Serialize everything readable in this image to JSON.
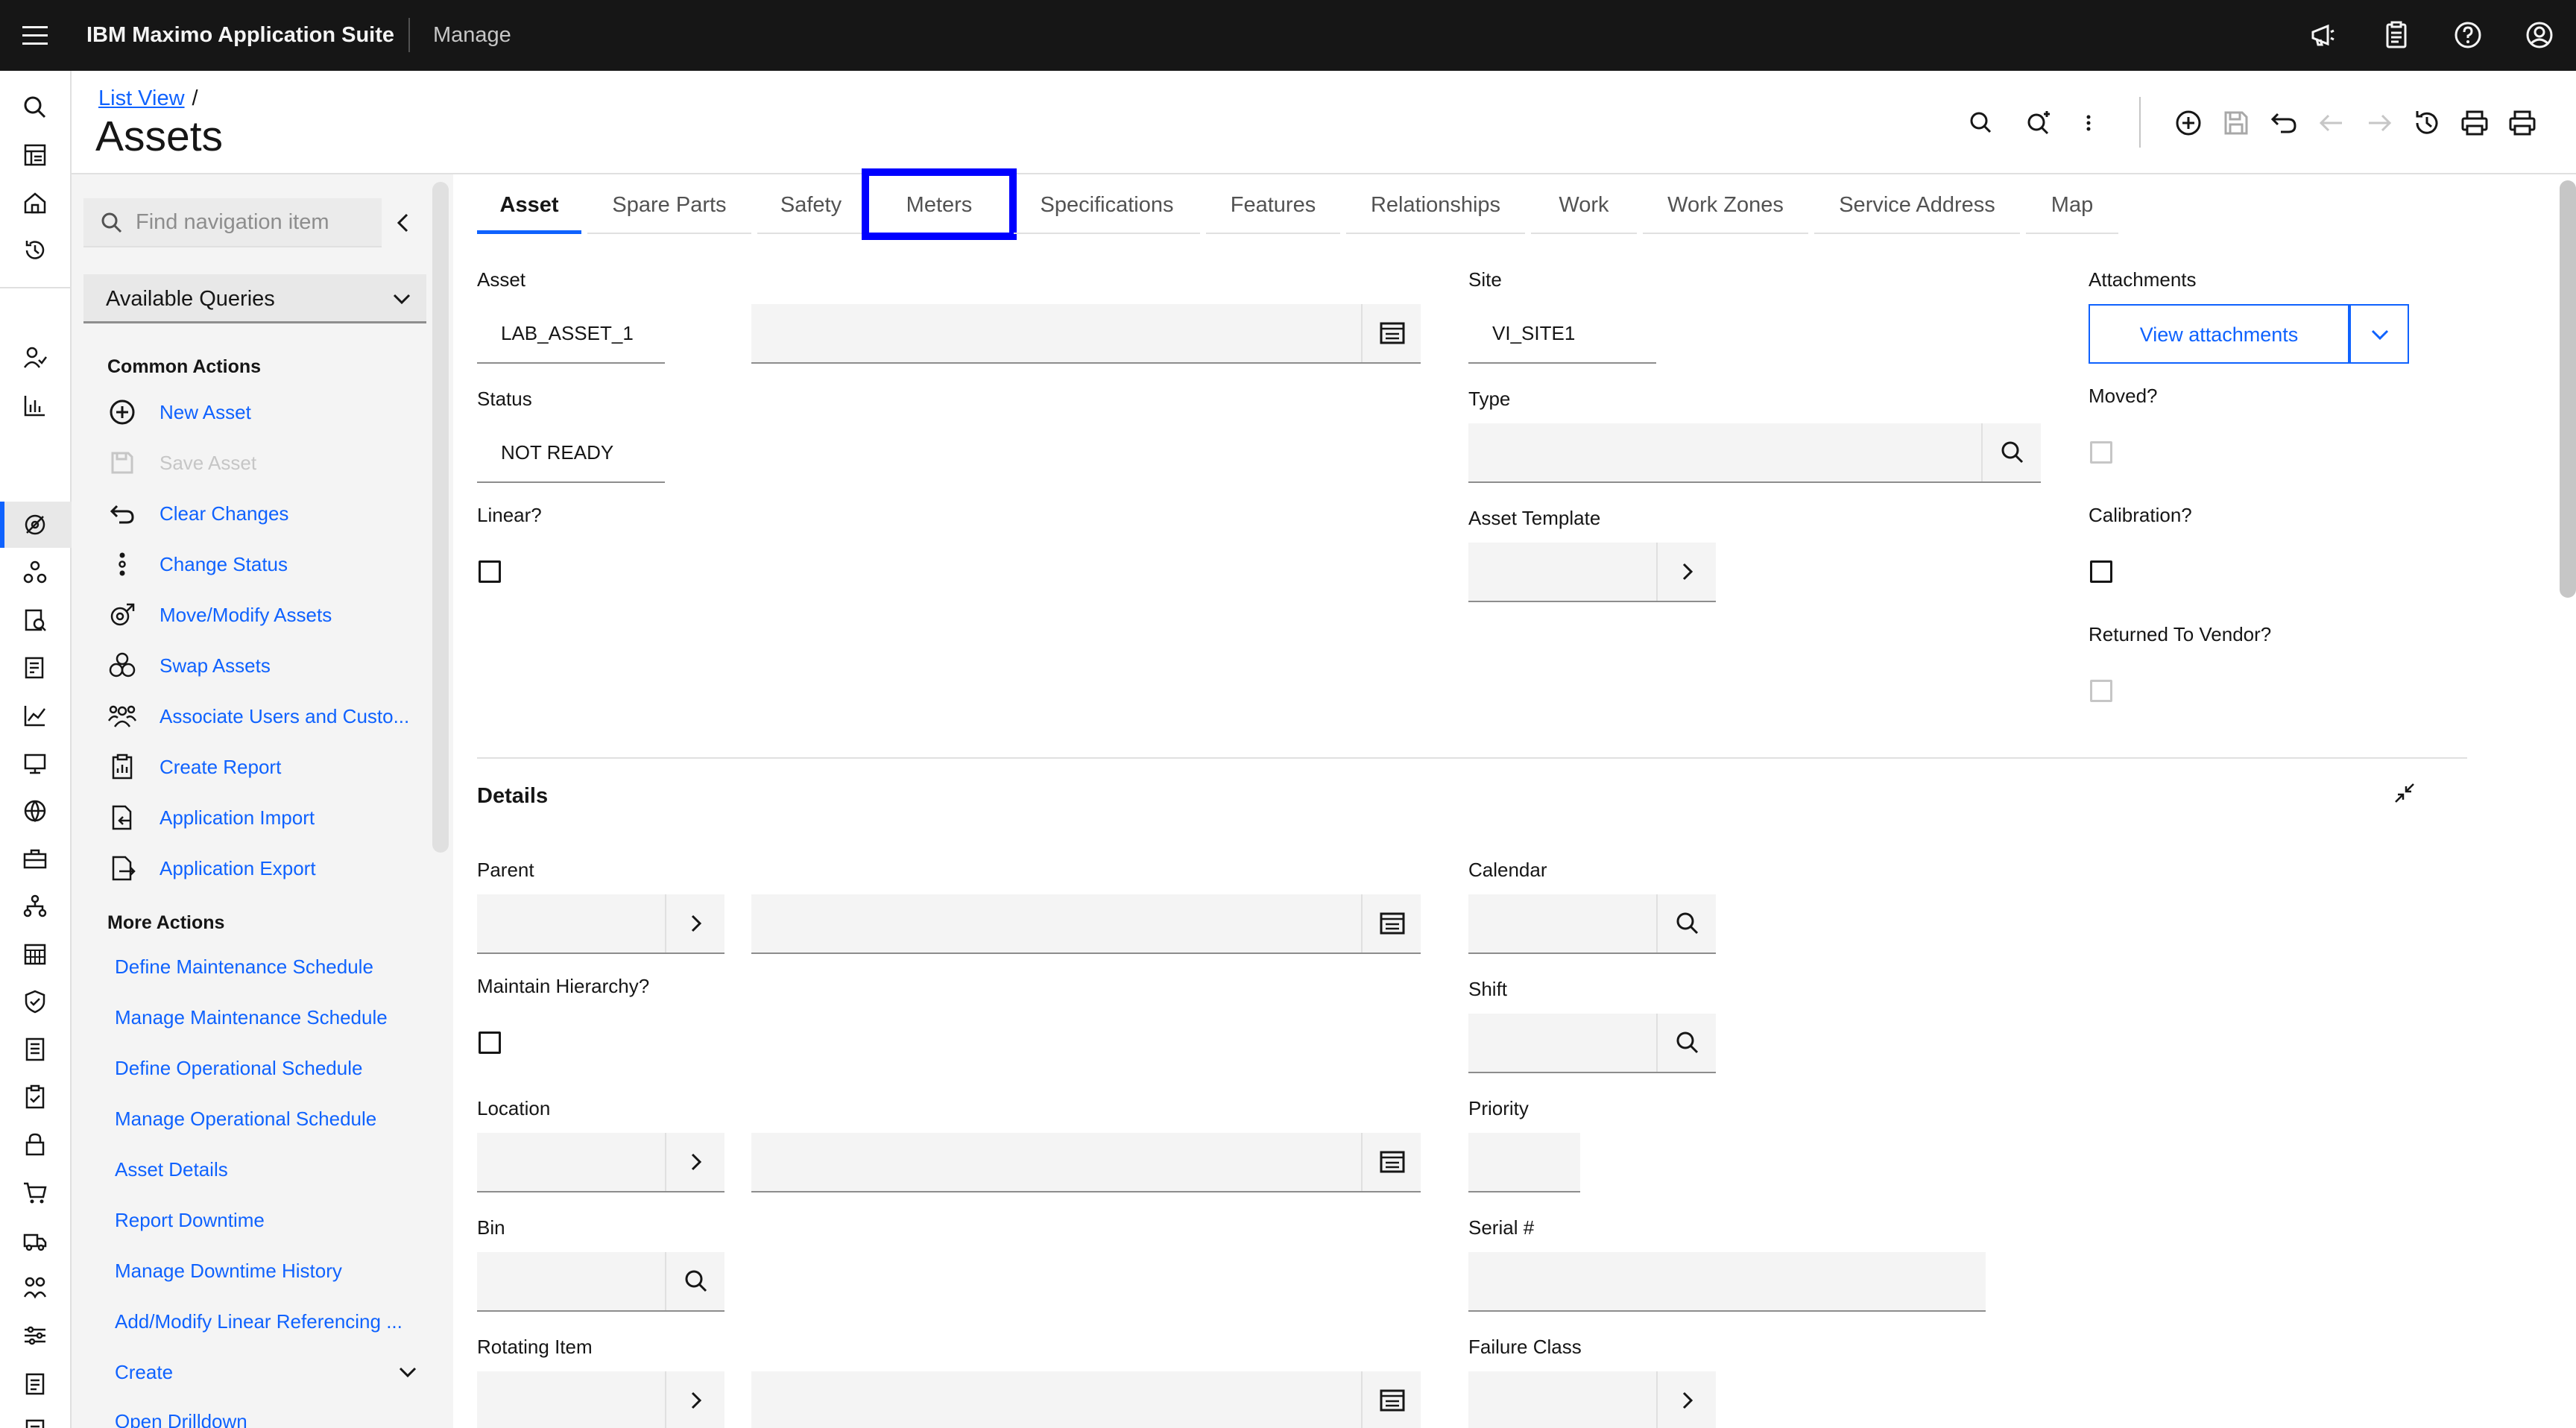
{
  "topbar": {
    "brand_bold": "IBM Maximo Application Suite",
    "app_name": "Manage",
    "icons": [
      "menu-icon",
      "announcement-icon",
      "clipboard-icon",
      "help-icon",
      "user-avatar-icon"
    ]
  },
  "header": {
    "breadcrumb_link": "List View",
    "breadcrumb_sep": "/",
    "title": "Assets"
  },
  "sidenav": {
    "search_placeholder": "Find navigation item",
    "queries_label": "Available Queries",
    "common_actions_title": "Common Actions",
    "common_actions": [
      {
        "label": "New Asset",
        "icon": "add-circle-icon",
        "enabled": true
      },
      {
        "label": "Save Asset",
        "icon": "save-icon",
        "enabled": false
      },
      {
        "label": "Clear Changes",
        "icon": "undo-icon",
        "enabled": true
      },
      {
        "label": "Change Status",
        "icon": "status-dots-icon",
        "enabled": true
      },
      {
        "label": "Move/Modify Assets",
        "icon": "move-assets-icon",
        "enabled": true
      },
      {
        "label": "Swap Assets",
        "icon": "swap-assets-icon",
        "enabled": true
      },
      {
        "label": "Associate Users and Custo...",
        "icon": "users-icon",
        "enabled": true
      },
      {
        "label": "Create Report",
        "icon": "report-icon",
        "enabled": true
      },
      {
        "label": "Application Import",
        "icon": "import-icon",
        "enabled": true
      },
      {
        "label": "Application Export",
        "icon": "export-icon",
        "enabled": true
      }
    ],
    "more_actions_title": "More Actions",
    "more_actions": [
      "Define Maintenance Schedule",
      "Manage Maintenance Schedule",
      "Define Operational Schedule",
      "Manage Operational Schedule",
      "Asset Details",
      "Report Downtime",
      "Manage Downtime History",
      "Add/Modify Linear Referencing ...",
      "Create",
      "Open Drilldown"
    ]
  },
  "tabs": [
    {
      "label": "Asset",
      "active": true
    },
    {
      "label": "Spare Parts"
    },
    {
      "label": "Safety"
    },
    {
      "label": "Meters",
      "focused": true
    },
    {
      "label": "Specifications"
    },
    {
      "label": "Features"
    },
    {
      "label": "Relationships"
    },
    {
      "label": "Work"
    },
    {
      "label": "Work Zones"
    },
    {
      "label": "Service Address"
    },
    {
      "label": "Map"
    }
  ],
  "form": {
    "asset_label": "Asset",
    "asset_value": "LAB_ASSET_1",
    "status_label": "Status",
    "status_value": "NOT READY",
    "linear_label": "Linear?",
    "site_label": "Site",
    "site_value": "VI_SITE1",
    "type_label": "Type",
    "asset_template_label": "Asset Template",
    "attachments_label": "Attachments",
    "view_attachments": "View attachments",
    "moved_label": "Moved?",
    "calibration_label": "Calibration?",
    "returned_label": "Returned To Vendor?"
  },
  "details": {
    "title": "Details",
    "parent_label": "Parent",
    "maintain_hierarchy_label": "Maintain Hierarchy?",
    "location_label": "Location",
    "bin_label": "Bin",
    "rotating_item_label": "Rotating Item",
    "calendar_label": "Calendar",
    "shift_label": "Shift",
    "priority_label": "Priority",
    "serial_label": "Serial #",
    "failure_class_label": "Failure Class"
  },
  "colors": {
    "brand_blue": "#0f62fe",
    "topbar_bg": "#161616",
    "focus_outline": "#0000ff"
  }
}
